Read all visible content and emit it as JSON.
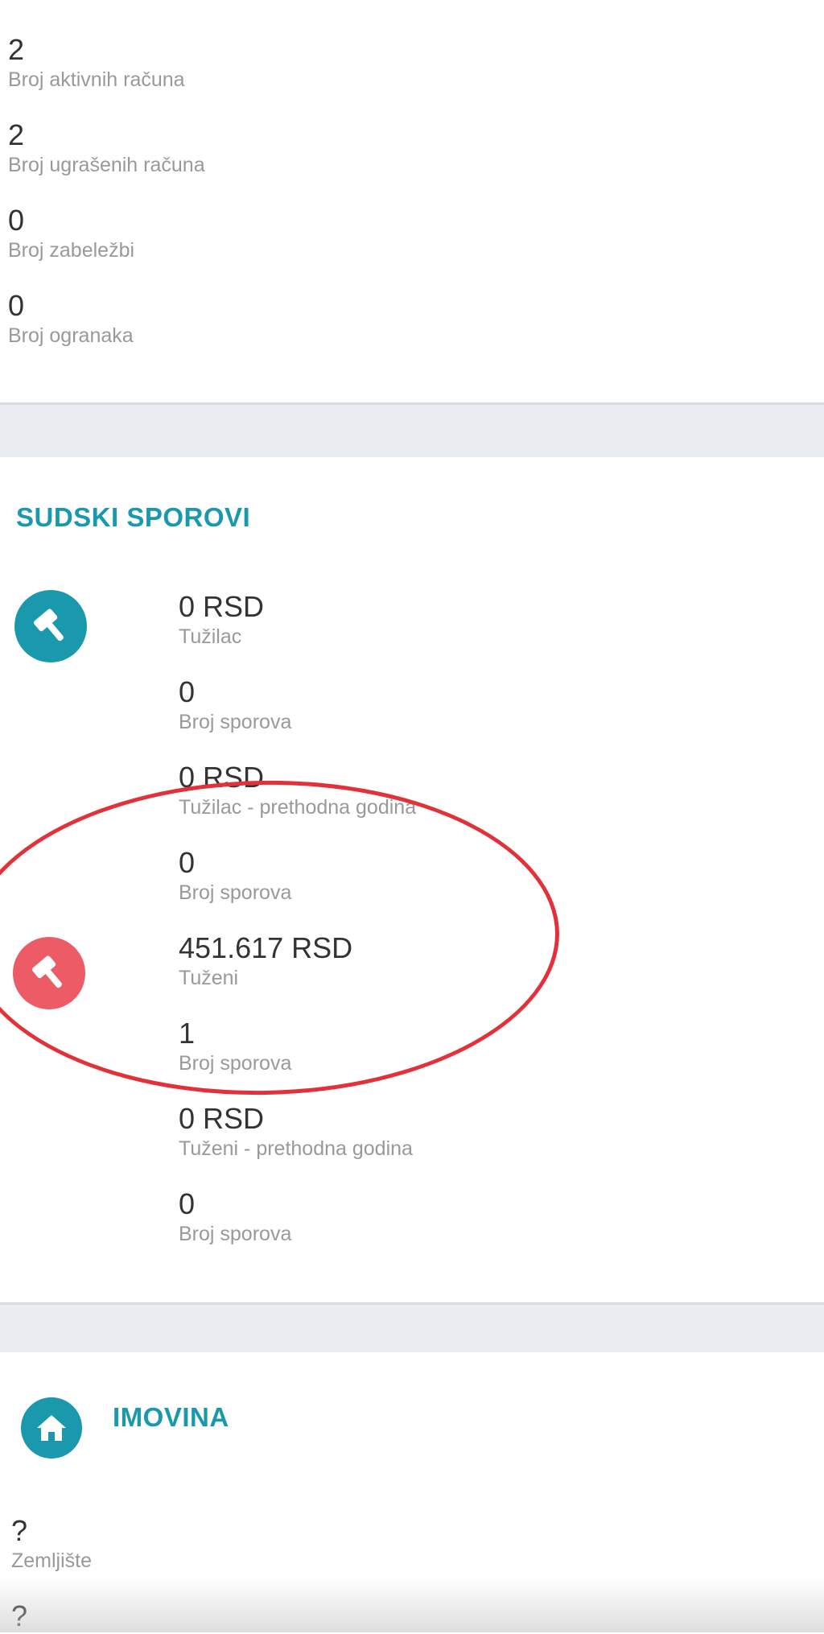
{
  "account_stats": [
    {
      "value": "2",
      "label": "Broj aktivnih računa"
    },
    {
      "value": "2",
      "label": "Broj ugrašenih računa"
    },
    {
      "value": "0",
      "label": "Broj zabeležbi"
    },
    {
      "value": "0",
      "label": "Broj ogranaka"
    }
  ],
  "courts": {
    "title": "SUDSKI SPOROVI",
    "plaintiff_icon": "gavel-icon",
    "plaintiff_color": "#1a98ac",
    "defendant_icon": "gavel-icon",
    "defendant_color": "#ec5b66",
    "items": [
      {
        "value": "0 RSD",
        "label": "Tužilac"
      },
      {
        "value": "0",
        "label": "Broj sporova"
      },
      {
        "value": "0 RSD",
        "label": "Tužilac - prethodna godina"
      },
      {
        "value": "0",
        "label": "Broj sporova"
      },
      {
        "value": "451.617 RSD",
        "label": "Tuženi"
      },
      {
        "value": "1",
        "label": "Broj sporova"
      },
      {
        "value": "0 RSD",
        "label": "Tuženi - prethodna godina"
      },
      {
        "value": "0",
        "label": "Broj sporova"
      }
    ],
    "highlight_color": "#e3313a"
  },
  "assets": {
    "title": "IMOVINA",
    "icon": "home-icon",
    "items": [
      {
        "value": "?",
        "label": "Zemljište"
      },
      {
        "value": "?",
        "label": ""
      }
    ]
  }
}
